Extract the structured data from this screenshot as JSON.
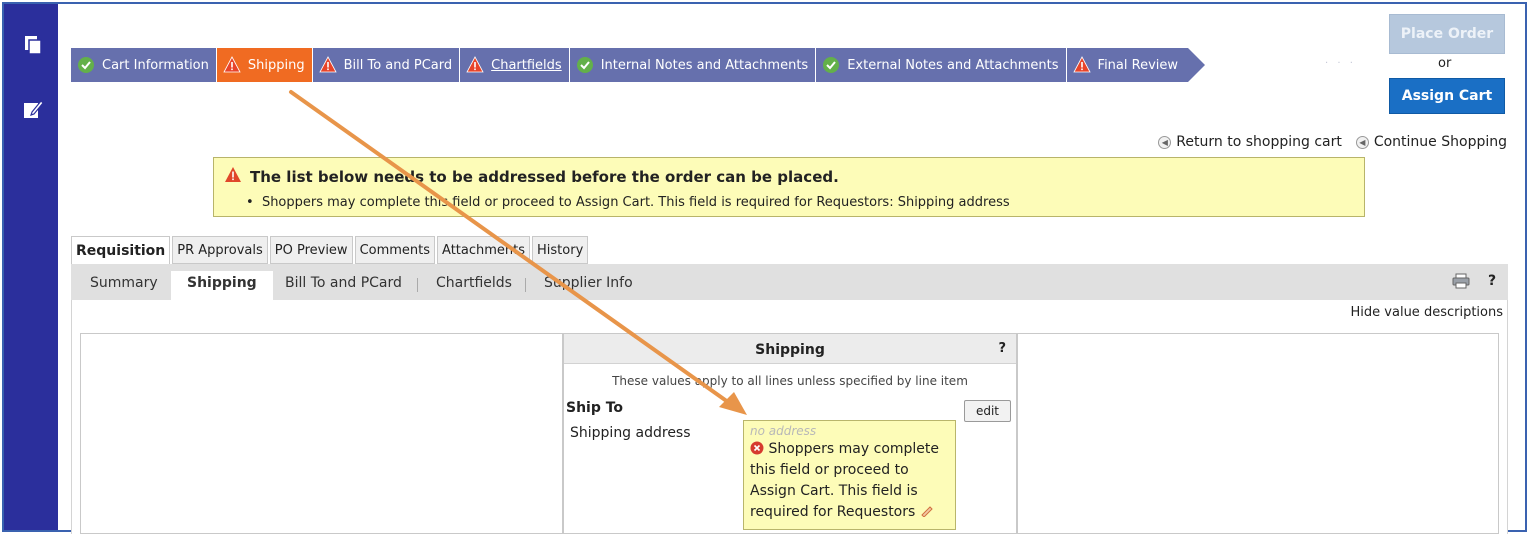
{
  "steps": [
    {
      "label": "Cart Information",
      "status": "ok"
    },
    {
      "label": "Shipping",
      "status": "warn"
    },
    {
      "label": "Bill To and PCard",
      "status": "warn"
    },
    {
      "label": "Chartfields",
      "status": "warn"
    },
    {
      "label": "Internal Notes and Attachments",
      "status": "ok"
    },
    {
      "label": "External Notes and Attachments",
      "status": "ok"
    },
    {
      "label": "Final Review",
      "status": "warn"
    }
  ],
  "actions": {
    "place_order": "Place Order",
    "or": "or",
    "assign_cart": "Assign Cart"
  },
  "links": {
    "return_cart": "Return to shopping cart",
    "continue_shopping": "Continue Shopping"
  },
  "alert": {
    "title": "The list below needs to be addressed before the order can be placed.",
    "item": "Shoppers may complete this field or proceed to Assign Cart. This field is required for Requestors: Shipping address"
  },
  "tabs": [
    "Requisition",
    "PR Approvals",
    "PO Preview",
    "Comments",
    "Attachments",
    "History"
  ],
  "subtabs": [
    "Summary",
    "Shipping",
    "Bill To and PCard",
    "Chartfields",
    "Supplier Info"
  ],
  "help": "?",
  "hide_desc": "Hide value descriptions",
  "shipping_panel": {
    "title": "Shipping",
    "help": "?",
    "note": "These values apply to all lines unless specified by line item",
    "ship_to": "Ship To",
    "shipping_address_label": "Shipping address",
    "edit": "edit",
    "no_address": "no address",
    "error_msg": "Shoppers may complete this field or proceed to Assign Cart. This field is required for Requestors"
  },
  "colors": {
    "sidebar": "#2b2f9c",
    "step": "#6670ad",
    "step_active": "#f06b22",
    "alert_bg": "#fdfcb8",
    "assign_btn": "#1a6fc5",
    "arrow": "#e8954a"
  }
}
